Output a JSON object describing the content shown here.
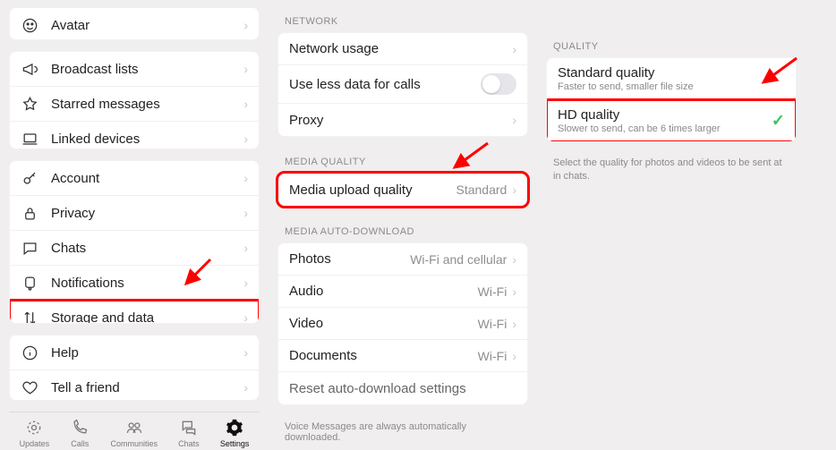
{
  "col1": {
    "group1": [
      {
        "icon": "avatar",
        "label": "Avatar"
      }
    ],
    "group2": [
      {
        "icon": "broadcast",
        "label": "Broadcast lists"
      },
      {
        "icon": "star",
        "label": "Starred messages"
      },
      {
        "icon": "laptop",
        "label": "Linked devices"
      }
    ],
    "group3": [
      {
        "icon": "key",
        "label": "Account"
      },
      {
        "icon": "lock",
        "label": "Privacy"
      },
      {
        "icon": "chat",
        "label": "Chats"
      },
      {
        "icon": "bell",
        "label": "Notifications"
      },
      {
        "icon": "arrows",
        "label": "Storage and data"
      }
    ],
    "group4": [
      {
        "icon": "info",
        "label": "Help"
      },
      {
        "icon": "heart",
        "label": "Tell a friend"
      }
    ]
  },
  "tabs": {
    "items": [
      {
        "label": "Updates"
      },
      {
        "label": "Calls"
      },
      {
        "label": "Communities"
      },
      {
        "label": "Chats"
      },
      {
        "label": "Settings"
      }
    ]
  },
  "col2": {
    "network_header": "NETWORK",
    "network": [
      {
        "label": "Network usage",
        "value": "",
        "type": "chev"
      },
      {
        "label": "Use less data for calls",
        "type": "toggle"
      },
      {
        "label": "Proxy",
        "value": "",
        "type": "chev"
      }
    ],
    "media_quality_header": "MEDIA QUALITY",
    "media_quality": {
      "label": "Media upload quality",
      "value": "Standard"
    },
    "auto_header": "MEDIA AUTO-DOWNLOAD",
    "auto": [
      {
        "label": "Photos",
        "value": "Wi-Fi and cellular"
      },
      {
        "label": "Audio",
        "value": "Wi-Fi"
      },
      {
        "label": "Video",
        "value": "Wi-Fi"
      },
      {
        "label": "Documents",
        "value": "Wi-Fi"
      }
    ],
    "reset_label": "Reset auto-download settings",
    "voice_note": "Voice Messages are always automatically downloaded."
  },
  "col3": {
    "header": "QUALITY",
    "options": [
      {
        "title": "Standard quality",
        "desc": "Faster to send, smaller file size",
        "selected": false
      },
      {
        "title": "HD quality",
        "desc": "Slower to send, can be 6 times larger",
        "selected": true
      }
    ],
    "note": "Select the quality for photos and videos to be sent at in chats."
  }
}
